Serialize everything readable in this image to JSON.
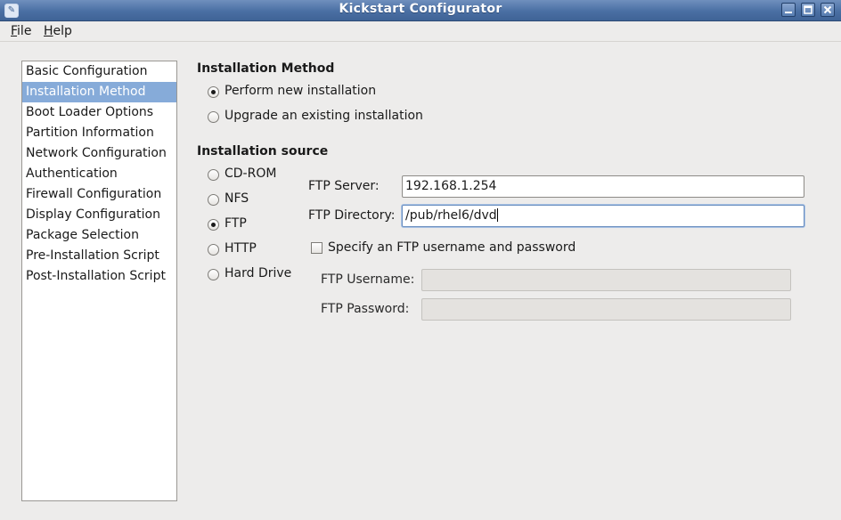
{
  "window": {
    "title": "Kickstart Configurator",
    "app_icon": "kickstart-app-icon",
    "controls": [
      "minimize-icon",
      "maximize-icon",
      "close-icon"
    ]
  },
  "menu": {
    "file": {
      "mnemonic": "F",
      "rest": "ile"
    },
    "help": {
      "mnemonic": "H",
      "rest": "elp"
    }
  },
  "sidebar": {
    "selected_index": 1,
    "selection_color": "#86abd9",
    "items": [
      {
        "label": "Basic Configuration"
      },
      {
        "label": "Installation Method"
      },
      {
        "label": "Boot Loader Options"
      },
      {
        "label": "Partition Information"
      },
      {
        "label": "Network Configuration"
      },
      {
        "label": "Authentication"
      },
      {
        "label": "Firewall Configuration"
      },
      {
        "label": "Display Configuration"
      },
      {
        "label": "Package Selection"
      },
      {
        "label": "Pre-Installation Script"
      },
      {
        "label": "Post-Installation Script"
      }
    ]
  },
  "installation_method": {
    "heading": "Installation Method",
    "options": [
      {
        "label": "Perform new installation",
        "selected": true
      },
      {
        "label": "Upgrade an existing installation",
        "selected": false
      }
    ]
  },
  "installation_source": {
    "heading": "Installation source",
    "options": [
      {
        "label": "CD-ROM",
        "selected": false
      },
      {
        "label": "NFS",
        "selected": false
      },
      {
        "label": "FTP",
        "selected": true
      },
      {
        "label": "HTTP",
        "selected": false
      },
      {
        "label": "Hard Drive",
        "selected": false
      }
    ]
  },
  "ftp": {
    "server_label": "FTP Server:",
    "server_value": "192.168.1.254",
    "directory_label": "FTP Directory:",
    "directory_value": "/pub/rhel6/dvd",
    "credentials_checkbox_label": "Specify an FTP username and password",
    "credentials_checked": false,
    "username_label": "FTP Username:",
    "username_value": "",
    "password_label": "FTP Password:",
    "password_value": ""
  }
}
